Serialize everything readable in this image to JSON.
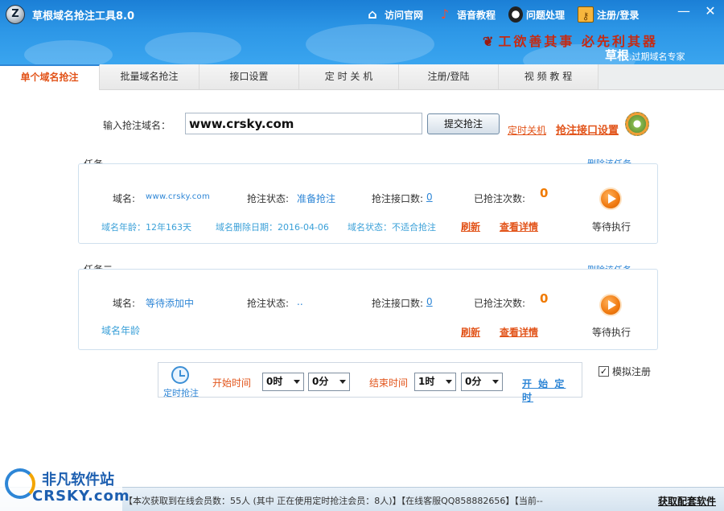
{
  "app": {
    "title": "草根域名抢注工具8.0",
    "logo_letter": "Z"
  },
  "top_links": [
    {
      "label": "访问官网",
      "icon": "home-icon"
    },
    {
      "label": "语音教程",
      "icon": "music-note-icon"
    },
    {
      "label": "问题处理",
      "icon": "qq-penguin-icon"
    },
    {
      "label": "注册/登录",
      "icon": "key-icon"
    }
  ],
  "window": {
    "minimize": "—",
    "close": "✕"
  },
  "banner": {
    "slogan": "工欲善其事 必先利其器",
    "brand": "草根",
    "brand_sub": ".过期域名专家"
  },
  "tabs": [
    {
      "label": "单个域名抢注",
      "active": true
    },
    {
      "label": "批量域名抢注"
    },
    {
      "label": "接口设置"
    },
    {
      "label": "定 时 关 机"
    },
    {
      "label": "注册/登陆"
    },
    {
      "label": "视 频 教 程"
    }
  ],
  "domain_entry": {
    "label": "输入抢注域名：",
    "value": "www.crsky.com",
    "submit": "提交抢注",
    "timer_shutdown": "定时关机",
    "api_settings": "抢注接口设置"
  },
  "task1": {
    "title": "任务一",
    "delete": "删除该任务",
    "domain_label": "域名:",
    "domain_value": "www.crsky.com",
    "status_label": "抢注状态:",
    "status_value": "准备抢注",
    "api_label": "抢注接口数:",
    "api_value": "0",
    "times_label": "已抢注次数:",
    "times_value": "0",
    "age": "域名年龄：12年163天",
    "delete_date": "域名删除日期：2016-04-06",
    "domain_state": "域名状态：不适合抢注",
    "refresh": "刷新",
    "details": "查看详情",
    "waiting": "等待执行"
  },
  "task2": {
    "title": "任务二",
    "delete": "删除该任务",
    "domain_label": "域名:",
    "domain_value": "等待添加中",
    "status_label": "抢注状态:",
    "status_value": "..",
    "api_label": "抢注接口数:",
    "api_value": "0",
    "times_label": "已抢注次数:",
    "times_value": "0",
    "age": "域名年龄",
    "refresh": "刷新",
    "details": "查看详情",
    "waiting": "等待执行"
  },
  "timer": {
    "label": "定时抢注",
    "start_label": "开始时间",
    "start_hour": "0时",
    "start_min": "0分",
    "end_label": "结束时间",
    "end_hour": "1时",
    "end_min": "0分",
    "start_button": "开 始 定 时"
  },
  "simulate": {
    "label": "模拟注册",
    "checked": true,
    "mark": "✓"
  },
  "status": {
    "text": "【本次获取到在线会员数：55人 (其中 正在使用定时抢注会员：8人)】【在线客服QQ858882656】【当前--",
    "get_software": "获取配套软件"
  },
  "watermark": {
    "cn": "非凡软件站",
    "en": "CRSKY.com"
  },
  "colors": {
    "titlebar": "#2c96e6",
    "accent_orange": "#e2541a",
    "link_blue": "#2e86d6",
    "count_orange": "#f07a00"
  }
}
